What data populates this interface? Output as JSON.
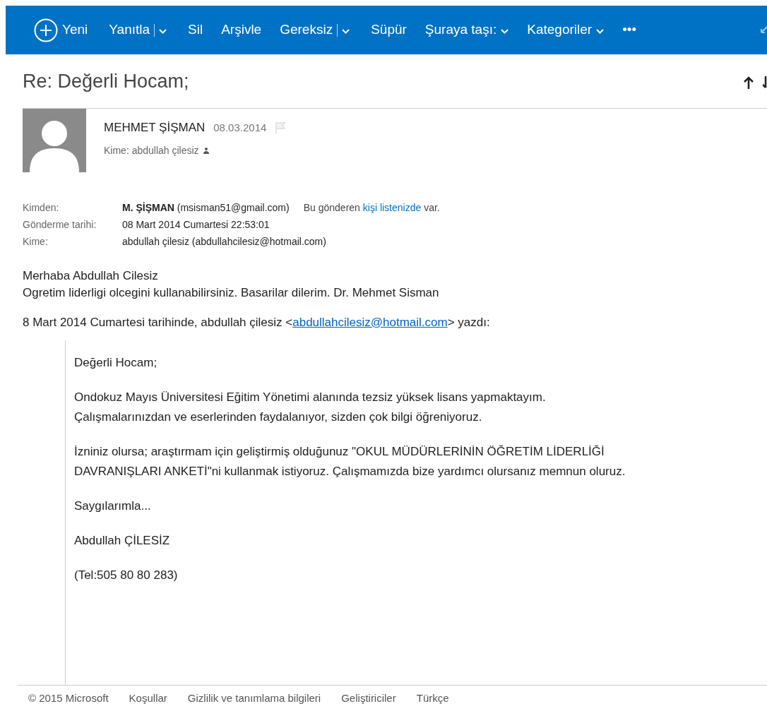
{
  "toolbar": [
    {
      "label": "Yeni",
      "kind": "new"
    },
    {
      "label": "Yanıtla",
      "kind": "split"
    },
    {
      "label": "Sil",
      "kind": "plain"
    },
    {
      "label": "Arşivle",
      "kind": "plain"
    },
    {
      "label": "Gereksiz",
      "kind": "split"
    },
    {
      "label": "Süpür",
      "kind": "plain"
    },
    {
      "label": "Şuraya taşı:",
      "kind": "menu"
    },
    {
      "label": "Kategoriler",
      "kind": "menu"
    },
    {
      "label": "•••",
      "kind": "plain"
    }
  ],
  "message": {
    "subject": "Re: Değerli Hocam;",
    "sender": {
      "name": "MEHMET ŞİŞMAN",
      "date": "08.03.2014",
      "recipients": "Kime: abdullah çilesiz"
    },
    "headers": [
      {
        "label": "Kimden:",
        "value": "**M. ŞİŞMAN** (msisman51@gmail.com)",
        "note": {
          "before": "Bu gönderen",
          "link": "kişi listenizde",
          "after": "var."
        }
      },
      {
        "label": "Gönderme tarihi:",
        "value": "08 Mart 2014 Cumartesi 22:53:01"
      },
      {
        "label": "Kime:",
        "value": "abdullah çilesiz (abdullahcilesiz@hotmail.com)"
      }
    ],
    "body": [
      "Merhaba Abdullah Cilesiz",
      "Ogretim liderligi olcegini kullanabilirsiniz. Basarilar dilerim. Dr. Mehmet Sisman"
    ],
    "attribution": {
      "before": "8 Mart 2014 Cumartesi tarihinde, abdullah çilesiz <",
      "link": "abdullahcilesiz@hotmail.com",
      "after": "> yazdı:"
    },
    "quote": [
      [
        "Değerli Hocam;"
      ],
      [
        "Ondokuz Mayıs Üniversitesi Eğitim Yönetimi alanında tezsiz yüksek lisans yapmaktayım.",
        "Çalışmalarınızdan ve eserlerinden faydalanıyor, sizden çok bilgi öğreniyoruz."
      ],
      [
        "İzniniz olursa; araştırmam için geliştirmiş olduğunuz \"OKUL MÜDÜRLERİNİN ÖĞRETİM LİDERLİĞİ",
        "DAVRANIŞLARI ANKETİ\"ni kullanmak istiyoruz. Çalışmamızda bize yardımcı olursanız memnun oluruz."
      ],
      [
        "Saygılarımla..."
      ],
      [
        "Abdullah ÇİLESİZ"
      ],
      [
        "(Tel:505 80 80 283)"
      ]
    ]
  },
  "footer": [
    "© 2015 Microsoft",
    "Koşullar",
    "Gizlilik ve tanımlama bilgileri",
    "Geliştiriciler",
    "Türkçe"
  ]
}
